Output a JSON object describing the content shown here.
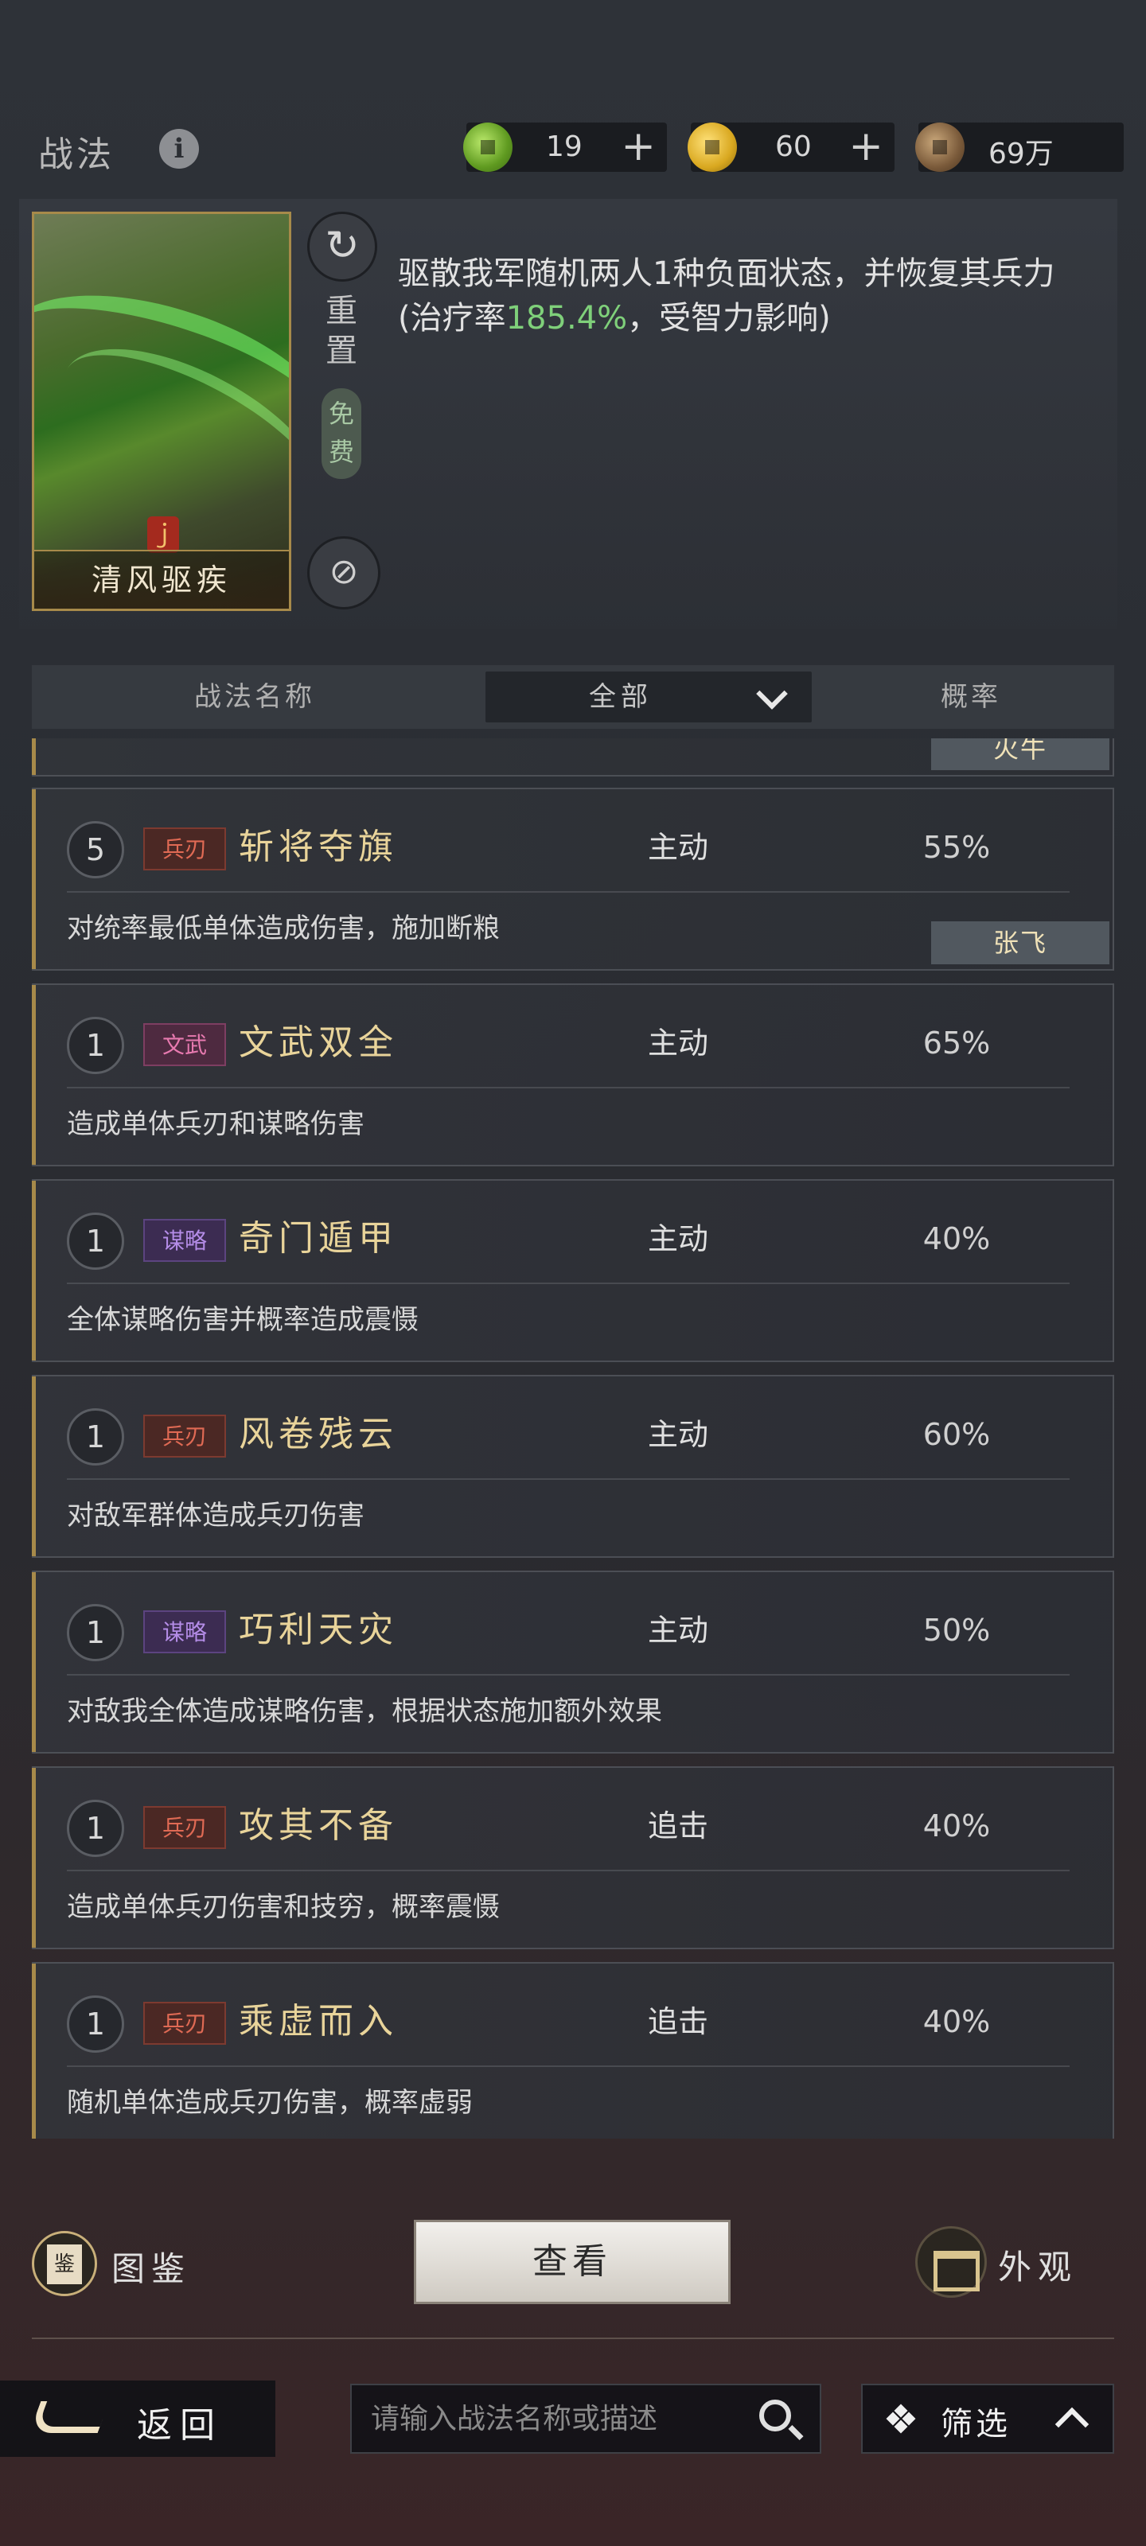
{
  "header": {
    "title": "战法",
    "info_icon": "info-icon",
    "resources": [
      {
        "icon": "jade-coin-icon",
        "value": "19",
        "plus": "+"
      },
      {
        "icon": "gold-coin-icon",
        "value": "60",
        "plus": "+"
      },
      {
        "icon": "copper-coin-icon",
        "value": "69万"
      }
    ]
  },
  "detail": {
    "card_name": "清风驱疾",
    "reset_label": "重置",
    "free_label": "免费",
    "description_pre": "驱散我军随机两人1种负面状态，并恢复其兵力(治疗率",
    "description_highlight": "185.4%",
    "description_post": "，受智力影响)",
    "highlight_color": "#7fd07a"
  },
  "list_header": {
    "name_col": "战法名称",
    "filter_value": "全部",
    "rate_col": "概率"
  },
  "partial_chip": "火牛",
  "items": [
    {
      "level": "5",
      "tag": "兵刃",
      "tag_color": "red",
      "name": "斩将夺旗",
      "type": "主动",
      "rate": "55%",
      "desc": "对统率最低单体造成伤害，施加断粮",
      "chip": "张飞"
    },
    {
      "level": "1",
      "tag": "文武",
      "tag_color": "pink",
      "name": "文武双全",
      "type": "主动",
      "rate": "65%",
      "desc": "造成单体兵刃和谋略伤害"
    },
    {
      "level": "1",
      "tag": "谋略",
      "tag_color": "purple",
      "name": "奇门遁甲",
      "type": "主动",
      "rate": "40%",
      "desc": "全体谋略伤害并概率造成震慑"
    },
    {
      "level": "1",
      "tag": "兵刃",
      "tag_color": "red",
      "name": "风卷残云",
      "type": "主动",
      "rate": "60%",
      "desc": "对敌军群体造成兵刃伤害"
    },
    {
      "level": "1",
      "tag": "谋略",
      "tag_color": "purple",
      "name": "巧利天灾",
      "type": "主动",
      "rate": "50%",
      "desc": "对敌我全体造成谋略伤害，根据状态施加额外效果"
    },
    {
      "level": "1",
      "tag": "兵刃",
      "tag_color": "red",
      "name": "攻其不备",
      "type": "追击",
      "rate": "40%",
      "desc": "造成单体兵刃伤害和技穷，概率震慑"
    },
    {
      "level": "1",
      "tag": "兵刃",
      "tag_color": "red",
      "name": "乘虚而入",
      "type": "追击",
      "rate": "40%",
      "desc": "随机单体造成兵刃伤害，概率虚弱"
    }
  ],
  "footer": {
    "atlas_label": "图鉴",
    "view_label": "查看",
    "skin_label": "外观",
    "back_label": "返回",
    "search_placeholder": "请输入战法名称或描述",
    "filter_label": "筛选"
  }
}
